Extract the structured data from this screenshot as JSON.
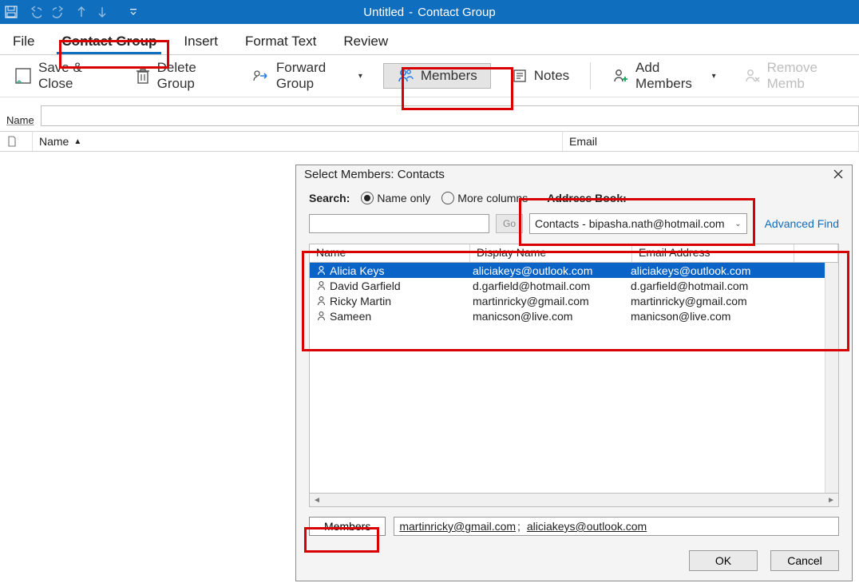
{
  "window": {
    "title_left": "Untitled",
    "title_sep": "-",
    "title_right": "Contact Group"
  },
  "tabs": {
    "file": "File",
    "contact_group": "Contact Group",
    "insert": "Insert",
    "format_text": "Format Text",
    "review": "Review"
  },
  "ribbon": {
    "save_close": "Save & Close",
    "delete_group": "Delete Group",
    "forward_group": "Forward Group",
    "members": "Members",
    "notes": "Notes",
    "add_members": "Add Members",
    "remove_members": "Remove Memb"
  },
  "name_field": {
    "label": "Name"
  },
  "list_header": {
    "name": "Name",
    "email": "Email"
  },
  "dialog": {
    "title": "Select Members: Contacts",
    "search_label": "Search:",
    "radio_name_only": "Name only",
    "radio_more_cols": "More columns",
    "address_book_label": "Address Book:",
    "go": "Go",
    "address_book_value": "Contacts - bipasha.nath@hotmail.com",
    "advanced_find": "Advanced Find",
    "columns": {
      "name": "Name",
      "display": "Display Name",
      "email": "Email Address"
    },
    "rows": [
      {
        "name": "Alicia Keys",
        "display": "aliciakeys@outlook.com",
        "email": "aliciakeys@outlook.com",
        "selected": true
      },
      {
        "name": "David Garfield",
        "display": "d.garfield@hotmail.com",
        "email": "d.garfield@hotmail.com",
        "selected": false
      },
      {
        "name": "Ricky Martin",
        "display": "martinricky@gmail.com",
        "email": "martinricky@gmail.com",
        "selected": false
      },
      {
        "name": "Sameen",
        "display": "manicson@live.com",
        "email": "manicson@live.com",
        "selected": false
      }
    ],
    "members_btn": "Members",
    "members_value_1": "martinricky@gmail.com",
    "members_value_sep": ";",
    "members_value_2": "aliciakeys@outlook.com",
    "ok": "OK",
    "cancel": "Cancel"
  }
}
